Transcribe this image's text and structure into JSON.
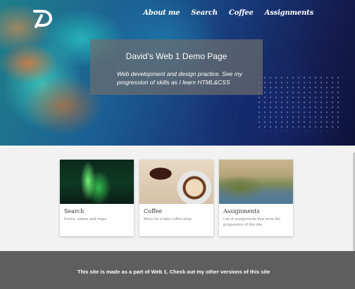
{
  "nav": {
    "items": [
      "About me",
      "Search",
      "Coffee",
      "Assignments"
    ]
  },
  "hero": {
    "title": "David’s Web 1 Demo Page",
    "subtitle": "Web development and design practice. See my progression of skills as I learn HTML&CSS"
  },
  "cards": [
    {
      "title": "Search",
      "description": "Forms, videos and maps"
    },
    {
      "title": "Coffee",
      "description": "Menu for a fake coffee shop"
    },
    {
      "title": "Assignments",
      "description": "List of assignments that show the progression of this site."
    }
  ],
  "footer": {
    "text": "This site is made as a part of Web 1. Check out my other versions of this site"
  },
  "colors": {
    "footer": "#5e5e5e",
    "page": "#f2f2f2"
  }
}
